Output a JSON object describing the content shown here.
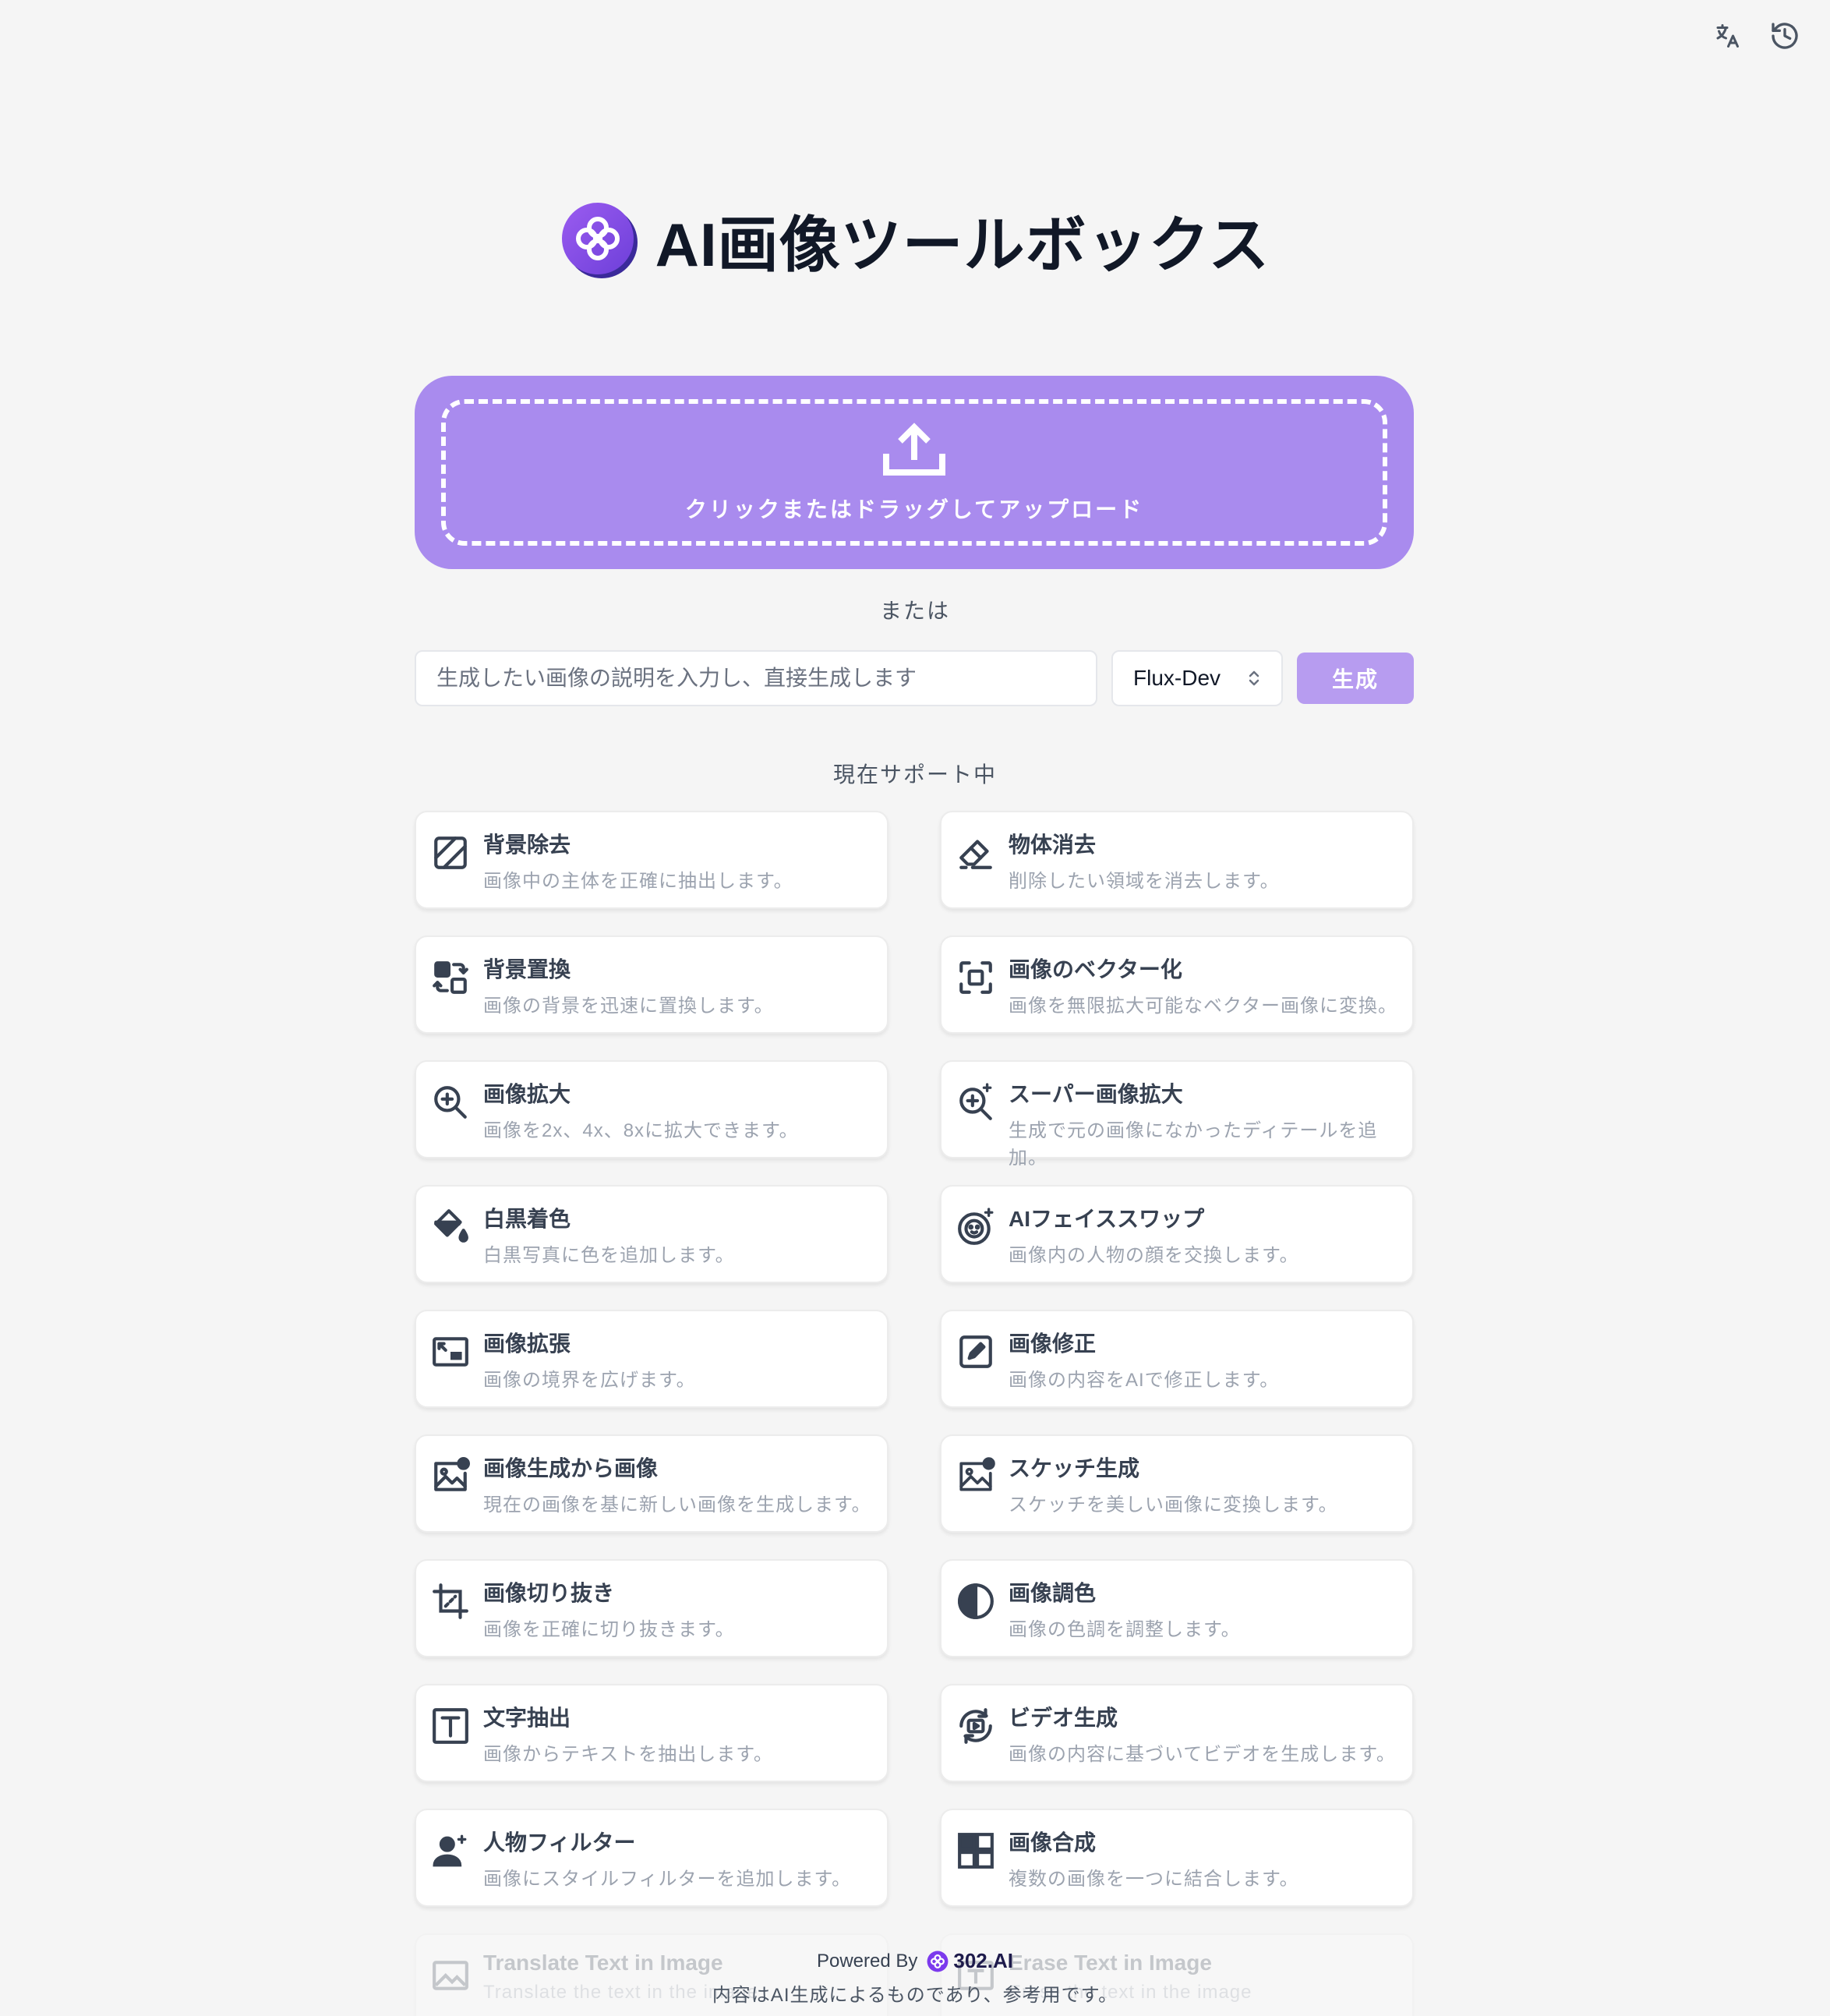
{
  "app": {
    "title": "AI画像ツールボックス",
    "accent": "#a98bee"
  },
  "topbar": {
    "translate_icon": "translate-icon",
    "history_icon": "history-icon"
  },
  "upload": {
    "label": "クリックまたはドラッグしてアップロード"
  },
  "or_text": "または",
  "generate": {
    "placeholder": "生成したい画像の説明を入力し、直接生成します",
    "value": "",
    "model": "Flux-Dev",
    "button": "生成"
  },
  "supported_title": "現在サポート中",
  "tools": [
    {
      "title": "背景除去",
      "desc": "画像中の主体を正確に抽出します。",
      "icon": "background-remove-icon"
    },
    {
      "title": "物体消去",
      "desc": "削除したい領域を消去します。",
      "icon": "eraser-icon"
    },
    {
      "title": "背景置換",
      "desc": "画像の背景を迅速に置換します。",
      "icon": "replace-icon"
    },
    {
      "title": "画像のベクター化",
      "desc": "画像を無限拡大可能なベクター画像に変換。",
      "icon": "vectorize-icon"
    },
    {
      "title": "画像拡大",
      "desc": "画像を2x、4x、8xに拡大できます。",
      "icon": "zoom-in-icon"
    },
    {
      "title": "スーパー画像拡大",
      "desc": "生成で元の画像になかったディテールを追加。",
      "icon": "super-zoom-icon"
    },
    {
      "title": "白黒着色",
      "desc": "白黒写真に色を追加します。",
      "icon": "paint-bucket-icon"
    },
    {
      "title": "AIフェイススワップ",
      "desc": "画像内の人物の顔を交換します。",
      "icon": "face-swap-icon"
    },
    {
      "title": "画像拡張",
      "desc": "画像の境界を広げます。",
      "icon": "expand-image-icon"
    },
    {
      "title": "画像修正",
      "desc": "画像の内容をAIで修正します。",
      "icon": "edit-icon"
    },
    {
      "title": "画像生成から画像",
      "desc": "現在の画像を基に新しい画像を生成します。",
      "icon": "image-plus-icon"
    },
    {
      "title": "スケッチ生成",
      "desc": "スケッチを美しい画像に変換します。",
      "icon": "sketch-icon"
    },
    {
      "title": "画像切り抜き",
      "desc": "画像を正確に切り抜きます。",
      "icon": "crop-icon"
    },
    {
      "title": "画像調色",
      "desc": "画像の色調を調整します。",
      "icon": "contrast-icon"
    },
    {
      "title": "文字抽出",
      "desc": "画像からテキストを抽出します。",
      "icon": "text-icon"
    },
    {
      "title": "ビデオ生成",
      "desc": "画像の内容に基づいてビデオを生成します。",
      "icon": "video-icon"
    },
    {
      "title": "人物フィルター",
      "desc": "画像にスタイルフィルターを追加します。",
      "icon": "person-filter-icon"
    },
    {
      "title": "画像合成",
      "desc": "複数の画像を一つに結合します。",
      "icon": "merge-icon"
    },
    {
      "title": "Translate Text in Image",
      "desc": "Translate the text in the image",
      "icon": "translate-image-icon"
    },
    {
      "title": "Erase Text in Image",
      "desc": "Erase the text in the image",
      "icon": "erase-text-icon"
    }
  ],
  "footer": {
    "powered_by": "Powered By",
    "brand": "302.AI",
    "note": "内容はAI生成によるものであり、参考用です。"
  }
}
